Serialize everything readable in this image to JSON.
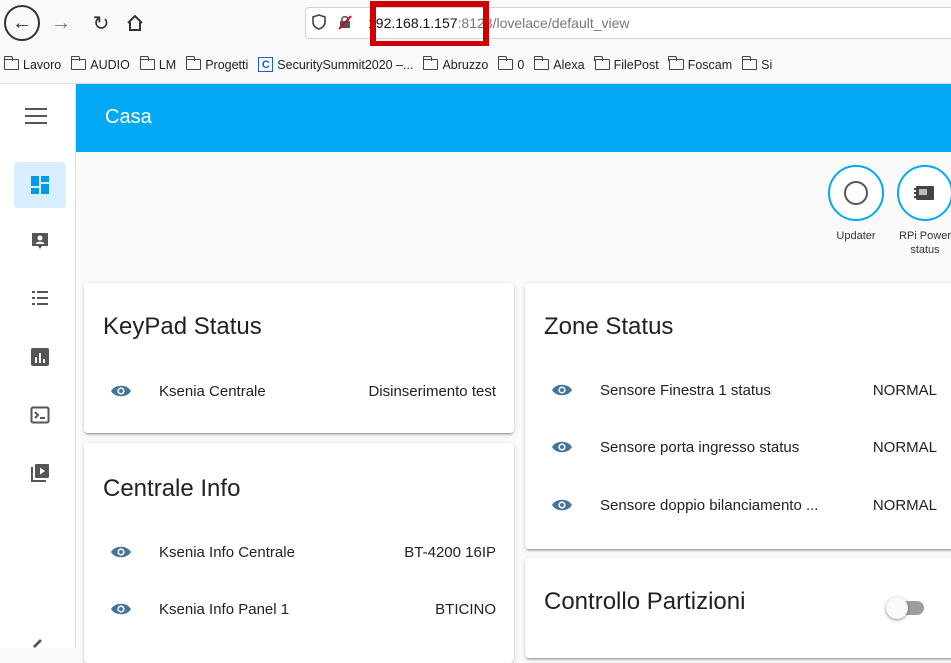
{
  "browser": {
    "url_host": "192.168.1.157",
    "url_rest": ":8123/lovelace/default_view",
    "bookmarks": [
      "Lavoro",
      "AUDIO",
      "LM",
      "Progetti",
      "SecuritySummit2020 –...",
      "Abruzzo",
      "0",
      "Alexa",
      "FilePost",
      "Foscam",
      "Si"
    ]
  },
  "app": {
    "title": "Casa",
    "accent_color": "#03a9f4",
    "sidebar_icons": [
      "dashboard-icon",
      "logbook-icon",
      "list-icon",
      "history-chart-icon",
      "terminal-icon",
      "media-icon"
    ]
  },
  "badges": [
    {
      "label": "Updater",
      "icon": "circle-icon"
    },
    {
      "label": "RPi Power status",
      "icon": "chip-icon"
    }
  ],
  "keypad_card": {
    "title": "KeyPad Status",
    "rows": [
      {
        "name": "Ksenia Centrale",
        "state": "Disinserimento test"
      }
    ]
  },
  "centrale_card": {
    "title": "Centrale Info",
    "rows": [
      {
        "name": "Ksenia Info Centrale",
        "state": "BT-4200 16IP"
      },
      {
        "name": "Ksenia Info Panel 1",
        "state": "BTICINO"
      }
    ]
  },
  "zone_card": {
    "title": "Zone Status",
    "rows": [
      {
        "name": "Sensore Finestra 1 status",
        "state": "NORMAL"
      },
      {
        "name": "Sensore porta ingresso status",
        "state": "NORMAL"
      },
      {
        "name": "Sensore doppio bilanciamento ...",
        "state": "NORMAL"
      }
    ]
  },
  "partizioni_card": {
    "title": "Controllo Partizioni",
    "toggle_on": false
  }
}
